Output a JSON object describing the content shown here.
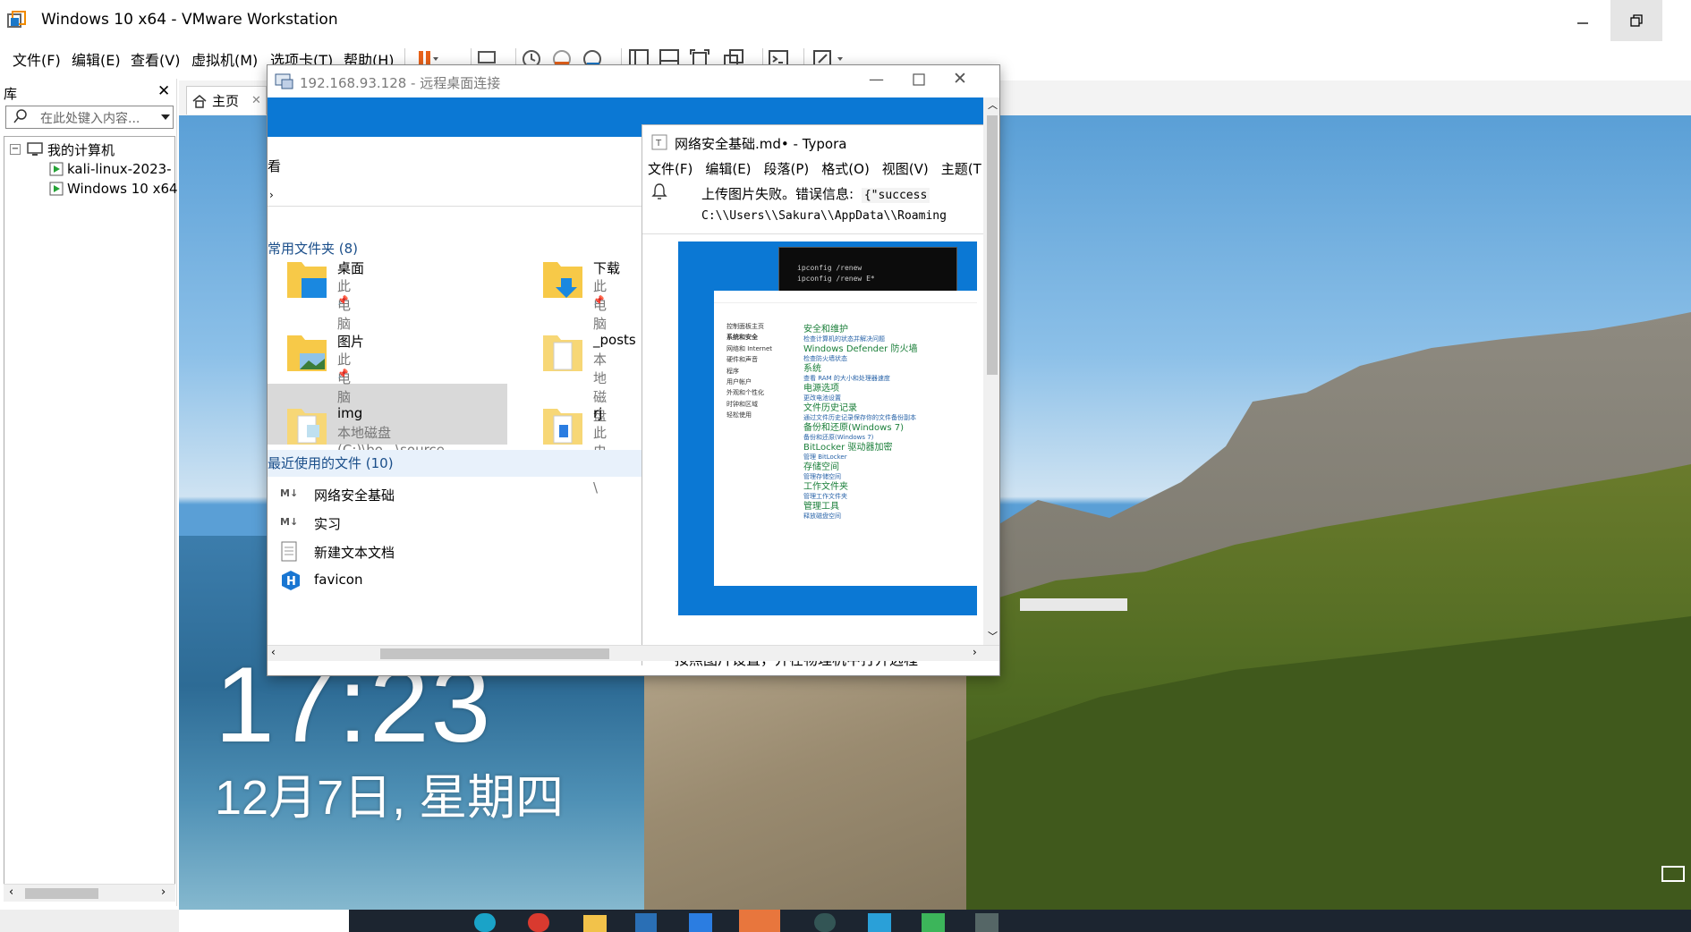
{
  "app": {
    "title": "Windows 10 x64 - VMware Workstation",
    "menus": [
      "文件(F)",
      "编辑(E)",
      "查看(V)",
      "虚拟机(M)",
      "选项卡(T)",
      "帮助(H)"
    ]
  },
  "library": {
    "title": "库",
    "search_placeholder": "在此处键入内容...",
    "tree": {
      "root": "我的计算机",
      "items": [
        "kali-linux-2023-",
        "Windows 10 x64"
      ]
    }
  },
  "vm_tabs": {
    "home": "主页"
  },
  "lockscreen": {
    "time": "17:23",
    "date": "12月7日, 星期四"
  },
  "rdp": {
    "title": "192.168.93.128 - 远程桌面连接",
    "explorer": {
      "view_label": "看",
      "frequent_header": "常用文件夹 (8)",
      "pinned": [
        {
          "name": "桌面",
          "location": "此电脑"
        },
        {
          "name": "下载",
          "location": "此电脑"
        },
        {
          "name": "图片",
          "location": "此电脑"
        },
        {
          "name": "_posts",
          "location": "本地磁盘"
        },
        {
          "name": "img",
          "location": "本地磁盘 (C:)\\bo...\\source"
        },
        {
          "name": "rj",
          "location": "此电脑\\"
        }
      ],
      "recent_header": "最近使用的文件 (10)",
      "recent": [
        "网络安全基础",
        "实习",
        "新建文本文档",
        "favicon"
      ]
    }
  },
  "typora": {
    "title": "网络安全基础.md• - Typora",
    "menus": [
      "文件(F)",
      "编辑(E)",
      "段落(P)",
      "格式(O)",
      "视图(V)",
      "主题(T"
    ],
    "error_prefix": "上传图片失败。错误信息:",
    "error_code": "{\"success",
    "error_path": "C:\\\\Users\\\\Sakura\\\\AppData\\\\Roaming",
    "body_text": "按照图片设置，并在物理机中打开远程",
    "screenshot": {
      "cmd_lines": [
        "ipconfig /renew",
        "ipconfig /renew E*"
      ],
      "cp_nav": [
        "控制面板主页",
        "系统和安全",
        "网络和 Internet",
        "硬件和声音",
        "程序",
        "用户帐户",
        "外观和个性化",
        "时钟和区域",
        "轻松使用"
      ],
      "cp_items": [
        {
          "title": "安全和维护",
          "sub": "检查计算机的状态并解决问题"
        },
        {
          "title": "Windows Defender 防火墙",
          "sub": "检查防火墙状态"
        },
        {
          "title": "系统",
          "sub": "查看 RAM 的大小和处理器速度"
        },
        {
          "title": "电源选项",
          "sub": "更改电池设置"
        },
        {
          "title": "文件历史记录",
          "sub": "通过文件历史记录保存你的文件备份副本"
        },
        {
          "title": "备份和还原(Windows 7)",
          "sub": "备份和还原(Windows 7)"
        },
        {
          "title": "BitLocker 驱动器加密",
          "sub": "管理 BitLocker"
        },
        {
          "title": "存储空间",
          "sub": "管理存储空间"
        },
        {
          "title": "工作文件夹",
          "sub": "管理工作文件夹"
        },
        {
          "title": "管理工具",
          "sub": "释放磁盘空间"
        }
      ]
    }
  }
}
